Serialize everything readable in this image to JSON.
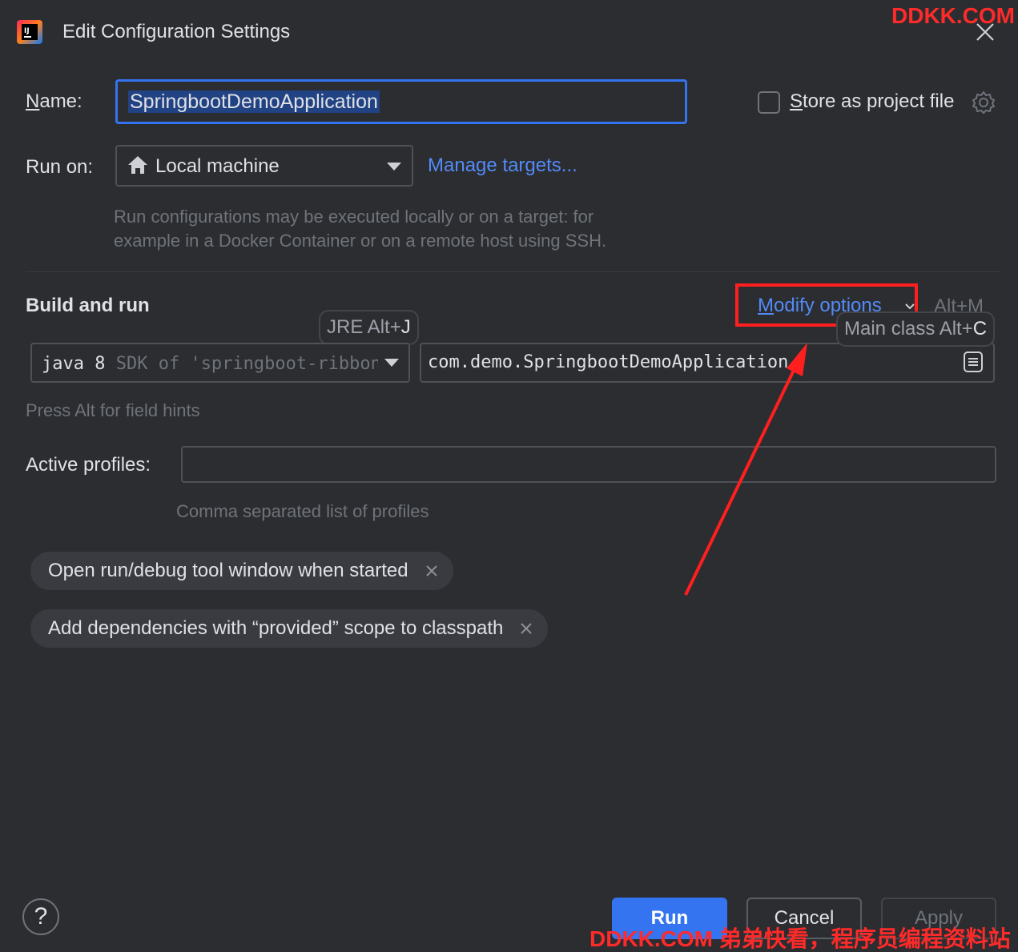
{
  "window": {
    "title": "Edit Configuration Settings",
    "watermark_top": "DDKK.COM",
    "watermark_bottom": "DDKK.COM 弟弟快看，程序员编程资料站"
  },
  "name": {
    "label_first": "N",
    "label_rest": "ame:",
    "value": "SpringbootDemoApplication"
  },
  "store": {
    "label_first": "S",
    "label_rest": "tore as project file",
    "checked": false
  },
  "run_on": {
    "label": "Run on:",
    "value": "Local machine",
    "manage_link": "Manage targets...",
    "hint_line1": "Run configurations may be executed locally or on a target: for",
    "hint_line2": "example in a Docker Container or on a remote host using SSH."
  },
  "build": {
    "section_title": "Build and run",
    "modify_first": "M",
    "modify_rest": "odify options",
    "modify_shortcut": "Alt+M",
    "jre_tooltip_text": "JRE Alt+",
    "jre_tooltip_key": "J",
    "main_tooltip_text": "Main class Alt+",
    "main_tooltip_key": "C",
    "jdk_main": "java 8",
    "jdk_dim": " SDK of 'springboot-ribbon'",
    "main_class": "com.demo.SpringbootDemoApplication",
    "field_hint": "Press Alt for field hints"
  },
  "profiles": {
    "label": "Active profiles:",
    "value": "",
    "hint": "Comma separated list of profiles"
  },
  "chips": [
    "Open run/debug tool window when started",
    "Add dependencies with “provided” scope to classpath"
  ],
  "footer": {
    "help": "?",
    "run": "Run",
    "cancel": "Cancel",
    "apply": "Apply"
  },
  "colors": {
    "background": "#2b2d30",
    "accent": "#3574f0",
    "link": "#548af7",
    "annotation": "#ff1f1f"
  }
}
